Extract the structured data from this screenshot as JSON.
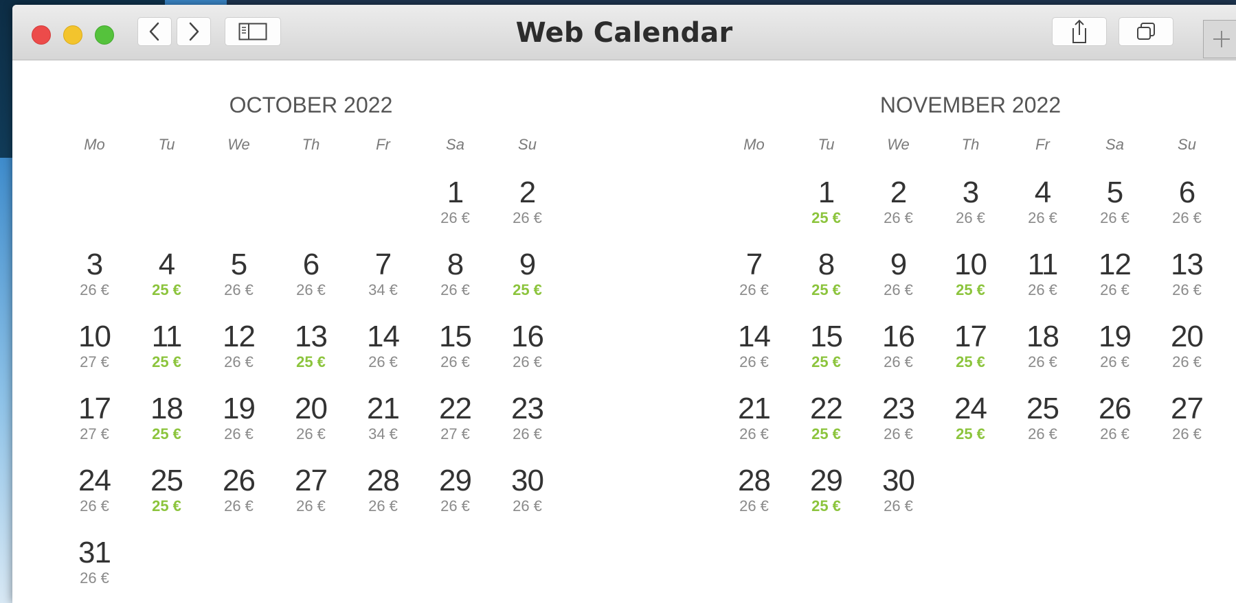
{
  "window": {
    "title": "Web Calendar"
  },
  "colors": {
    "accent_low_price": "#8cc43d",
    "regular_price": "#8a8a8a"
  },
  "icons": [
    "back-chevron-icon",
    "forward-chevron-icon",
    "sidebar-icon",
    "share-icon",
    "tabs-icon",
    "plus-icon"
  ],
  "weekdays": [
    "Mo",
    "Tu",
    "We",
    "Th",
    "Fr",
    "Sa",
    "Su"
  ],
  "months": [
    {
      "title": "OCTOBER 2022",
      "leading_blanks": 5,
      "days": [
        {
          "d": "1",
          "p": "26 €",
          "low": false
        },
        {
          "d": "2",
          "p": "26 €",
          "low": false
        },
        {
          "d": "3",
          "p": "26 €",
          "low": false
        },
        {
          "d": "4",
          "p": "25 €",
          "low": true
        },
        {
          "d": "5",
          "p": "26 €",
          "low": false
        },
        {
          "d": "6",
          "p": "26 €",
          "low": false
        },
        {
          "d": "7",
          "p": "34 €",
          "low": false
        },
        {
          "d": "8",
          "p": "26 €",
          "low": false
        },
        {
          "d": "9",
          "p": "25 €",
          "low": true
        },
        {
          "d": "10",
          "p": "27 €",
          "low": false
        },
        {
          "d": "11",
          "p": "25 €",
          "low": true
        },
        {
          "d": "12",
          "p": "26 €",
          "low": false
        },
        {
          "d": "13",
          "p": "25 €",
          "low": true
        },
        {
          "d": "14",
          "p": "26 €",
          "low": false
        },
        {
          "d": "15",
          "p": "26 €",
          "low": false
        },
        {
          "d": "16",
          "p": "26 €",
          "low": false
        },
        {
          "d": "17",
          "p": "27 €",
          "low": false
        },
        {
          "d": "18",
          "p": "25 €",
          "low": true
        },
        {
          "d": "19",
          "p": "26 €",
          "low": false
        },
        {
          "d": "20",
          "p": "26 €",
          "low": false
        },
        {
          "d": "21",
          "p": "34 €",
          "low": false
        },
        {
          "d": "22",
          "p": "27 €",
          "low": false
        },
        {
          "d": "23",
          "p": "26 €",
          "low": false
        },
        {
          "d": "24",
          "p": "26 €",
          "low": false
        },
        {
          "d": "25",
          "p": "25 €",
          "low": true
        },
        {
          "d": "26",
          "p": "26 €",
          "low": false
        },
        {
          "d": "27",
          "p": "26 €",
          "low": false
        },
        {
          "d": "28",
          "p": "26 €",
          "low": false
        },
        {
          "d": "29",
          "p": "26 €",
          "low": false
        },
        {
          "d": "30",
          "p": "26 €",
          "low": false
        },
        {
          "d": "31",
          "p": "26 €",
          "low": false
        }
      ]
    },
    {
      "title": "NOVEMBER 2022",
      "leading_blanks": 1,
      "days": [
        {
          "d": "1",
          "p": "25 €",
          "low": true
        },
        {
          "d": "2",
          "p": "26 €",
          "low": false
        },
        {
          "d": "3",
          "p": "26 €",
          "low": false
        },
        {
          "d": "4",
          "p": "26 €",
          "low": false
        },
        {
          "d": "5",
          "p": "26 €",
          "low": false
        },
        {
          "d": "6",
          "p": "26 €",
          "low": false
        },
        {
          "d": "7",
          "p": "26 €",
          "low": false
        },
        {
          "d": "8",
          "p": "25 €",
          "low": true
        },
        {
          "d": "9",
          "p": "26 €",
          "low": false
        },
        {
          "d": "10",
          "p": "25 €",
          "low": true
        },
        {
          "d": "11",
          "p": "26 €",
          "low": false
        },
        {
          "d": "12",
          "p": "26 €",
          "low": false
        },
        {
          "d": "13",
          "p": "26 €",
          "low": false
        },
        {
          "d": "14",
          "p": "26 €",
          "low": false
        },
        {
          "d": "15",
          "p": "25 €",
          "low": true
        },
        {
          "d": "16",
          "p": "26 €",
          "low": false
        },
        {
          "d": "17",
          "p": "25 €",
          "low": true
        },
        {
          "d": "18",
          "p": "26 €",
          "low": false
        },
        {
          "d": "19",
          "p": "26 €",
          "low": false
        },
        {
          "d": "20",
          "p": "26 €",
          "low": false
        },
        {
          "d": "21",
          "p": "26 €",
          "low": false
        },
        {
          "d": "22",
          "p": "25 €",
          "low": true
        },
        {
          "d": "23",
          "p": "26 €",
          "low": false
        },
        {
          "d": "24",
          "p": "25 €",
          "low": true
        },
        {
          "d": "25",
          "p": "26 €",
          "low": false
        },
        {
          "d": "26",
          "p": "26 €",
          "low": false
        },
        {
          "d": "27",
          "p": "26 €",
          "low": false
        },
        {
          "d": "28",
          "p": "26 €",
          "low": false
        },
        {
          "d": "29",
          "p": "25 €",
          "low": true
        },
        {
          "d": "30",
          "p": "26 €",
          "low": false
        }
      ]
    }
  ]
}
